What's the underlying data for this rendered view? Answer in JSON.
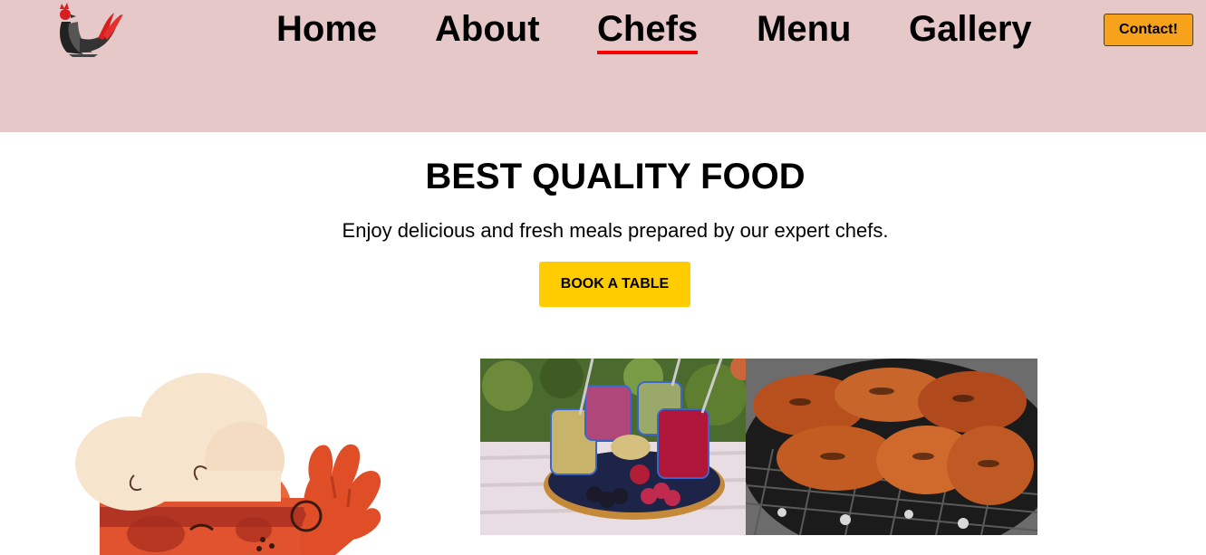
{
  "header": {
    "logo_icon": "rooster-icon",
    "nav": [
      {
        "label": "Home",
        "active": false
      },
      {
        "label": "About",
        "active": false
      },
      {
        "label": "Chefs",
        "active": true
      },
      {
        "label": "Menu",
        "active": false
      },
      {
        "label": "Gallery",
        "active": false
      }
    ],
    "contact_label": "Contact!",
    "active_underline_color": "#ff0000",
    "background_color": "#e6c8c8"
  },
  "hero": {
    "title": "BEST QUALITY FOOD",
    "subtitle": "Enjoy delicious and fresh meals prepared by our expert chefs.",
    "button_label": "BOOK A TABLE",
    "button_color": "#ffcc00"
  },
  "images": {
    "chef_illustration": "chef-illustration",
    "photos": [
      "smoothies-photo",
      "grilled-chicken-photo"
    ]
  }
}
